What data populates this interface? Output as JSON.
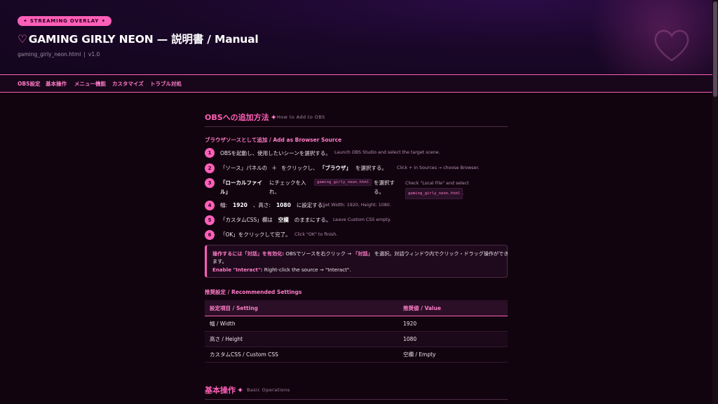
{
  "hero": {
    "badge": "✦ STREAMING OVERLAY ✦",
    "title_heart": "♡",
    "title": "GAMING GIRLY NEON — 説明書 / Manual",
    "filename": "gaming_girly_neon.html",
    "separator": "|",
    "version": "v1.0"
  },
  "nav": {
    "items": [
      "OBS設定",
      "基本操作",
      "メニュー機能",
      "カスタマイズ",
      "トラブル対処"
    ]
  },
  "section1": {
    "title": "OBSへの追加方法",
    "spark": "✦",
    "subtitle": "How to Add to OBS"
  },
  "browser_source": {
    "heading": "ブラウザソースとして追加 / Add as Browser Source"
  },
  "steps": [
    {
      "num": "1",
      "jp": "OBSを起動し、使用したいシーンを選択する。",
      "en": "Launch OBS Studio and select the target scene."
    },
    {
      "num": "2",
      "jp_a": "「ソース」パネルの",
      "plus": "＋",
      "jp_b": "をクリックし、",
      "jp_bold": "「ブラウザ」",
      "jp_c": "を選択する。",
      "en": "Click + in Sources → choose Browser."
    },
    {
      "num": "3",
      "jp_bold_1": "「ローカルファイ",
      "jp_bold_2": "ル」",
      "jp_a1": "にチェックを入",
      "jp_a2": "れ、",
      "code": "gaming_girly_neon.html",
      "jp_b1": "を選択す",
      "jp_b2": "る。",
      "en_1": "Check \"Local File\" and select",
      "en_code": "gaming_girly_neon.html",
      "en_end": "."
    },
    {
      "num": "4",
      "jp_a": "幅:",
      "width": "1920",
      "jp_b": "、高さ:",
      "height": "1080",
      "jp_c": "に設定する。",
      "en": "Set Width: 1920, Height: 1080."
    },
    {
      "num": "5",
      "jp_a": "「カスタムCSS」欄は",
      "jp_bold": "空欄",
      "jp_b": "のままにする。",
      "en": "Leave Custom CSS empty."
    },
    {
      "num": "6",
      "jp": "「OK」をクリックして完了。",
      "en": "Click \"OK\" to finish."
    }
  ],
  "note": {
    "strong_1": "操作するには「対話」を有効化:",
    "text_1a": " OBSでソースを右クリック → ",
    "strong_2": "「対話」",
    "text_1b": " を選択。対話ウィンドウ内でクリック・ドラッグ操作ができ",
    "text_2": "ます。",
    "strong_3": "Enable \"Interact\":",
    "text_3": " Right-click the source → \"Interact\"."
  },
  "recommended": {
    "heading": "推奨設定 / Recommended Settings",
    "columns": [
      "設定項目 / Setting",
      "推奨値 / Value"
    ],
    "rows": [
      [
        "幅 / Width",
        "1920"
      ],
      [
        "高さ / Height",
        "1080"
      ],
      [
        "カスタムCSS / Custom CSS",
        "空欄 / Empty"
      ]
    ]
  },
  "section2": {
    "title": "基本操作",
    "spark": "✦",
    "subtitle": "Basic Operations"
  },
  "colors": {
    "accent": "#ff5fb8",
    "accent_light": "#ff7cc8",
    "background": "#12040f",
    "hero_bg": "#1a0729"
  }
}
